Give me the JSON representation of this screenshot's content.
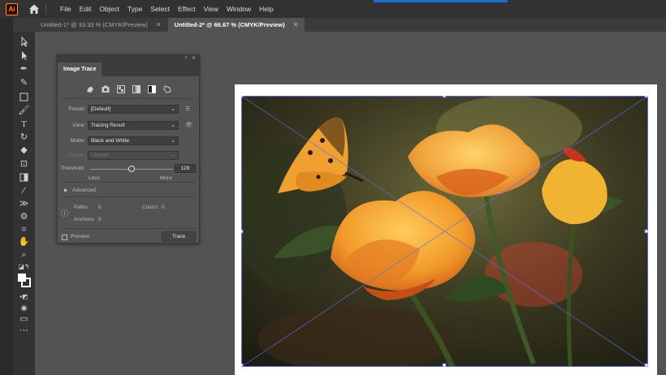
{
  "menubar": {
    "logo": "Ai",
    "items": [
      "File",
      "Edit",
      "Object",
      "Type",
      "Select",
      "Effect",
      "View",
      "Window",
      "Help"
    ]
  },
  "tabs": [
    {
      "label": "Untitled-1* @ 33.33 % (CMYK/Preview)",
      "active": false
    },
    {
      "label": "Untitled-2* @ 66.67 % (CMYK/Preview)",
      "active": true
    }
  ],
  "panel": {
    "title": "Image Trace",
    "preset_label": "Preset:",
    "preset_value": "[Default]",
    "view_label": "View:",
    "view_value": "Tracing Result",
    "mode_label": "Mode:",
    "mode_value": "Black and White",
    "palette_label": "Palette:",
    "palette_value": "Limited",
    "threshold_label": "Threshold:",
    "threshold_value": "128",
    "threshold_fraction": 0.5,
    "less_label": "Less",
    "more_label": "More",
    "advanced_label": "Advanced",
    "paths_label": "Paths:",
    "paths_value": "0",
    "colors_label": "Colors:",
    "colors_value": "0",
    "anchors_label": "Anchors:",
    "anchors_value": "0",
    "preview_label": "Preview",
    "trace_label": "Trace"
  },
  "colors": {
    "accent": "#1a6fd0",
    "ai_brand": "#ff9a00"
  }
}
